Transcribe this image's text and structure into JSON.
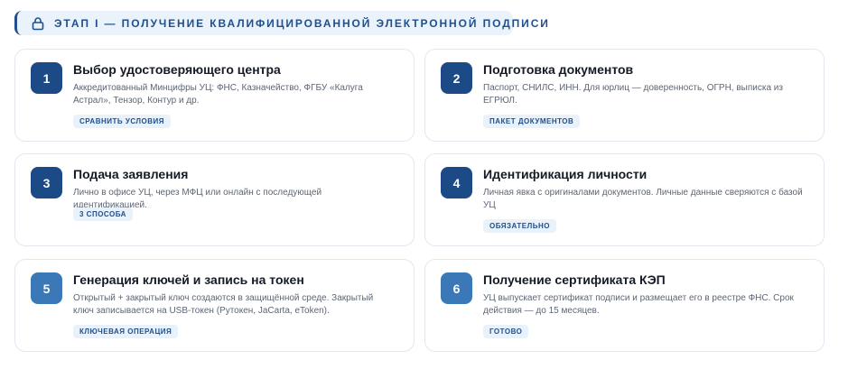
{
  "stage": {
    "title": "ЭТАП I — ПОЛУЧЕНИЕ КВАЛИФИЦИРОВАННОЙ ЭЛЕКТРОННОЙ ПОДПИСИ",
    "icon": "lock-icon"
  },
  "colors": {
    "accent": "#1f4f8c",
    "badge_dark": "#1b4a86",
    "badge_light": "#3a78b8"
  },
  "steps": [
    {
      "number": "1",
      "title": "Выбор удостоверяющего центра",
      "description": "Аккредитованный Минцифры УЦ: ФНС, Казначейство, ФГБУ «Калуга Астрал», Тензор, Контур и др.",
      "tag": "СРАВНИТЬ УСЛОВИЯ"
    },
    {
      "number": "2",
      "title": "Подготовка документов",
      "description": "Паспорт, СНИЛС, ИНН. Для юрлиц — доверенность, ОГРН, выписка из ЕГРЮЛ.",
      "tag": "ПАКЕТ ДОКУМЕНТОВ"
    },
    {
      "number": "3",
      "title": "Подача заявления",
      "description": "Лично в офисе УЦ, через МФЦ или онлайн с последующей идентификацией.",
      "tag": "3 СПОСОБА"
    },
    {
      "number": "4",
      "title": "Идентификация личности",
      "description": "Личная явка с оригиналами документов. Личные данные сверяются с базой УЦ",
      "tag": "ОБЯЗАТЕЛЬНО"
    },
    {
      "number": "5",
      "title": "Генерация ключей и запись на токен",
      "description": "Открытый + закрытый ключ создаются в защищённой среде. Закрытый ключ записывается на USB-токен (Рутокен, JaCarta, eToken).",
      "tag": "КЛЮЧЕВАЯ ОПЕРАЦИЯ"
    },
    {
      "number": "6",
      "title": "Получение сертификата КЭП",
      "description": "УЦ выпускает сертификат подписи и размещает его в реестре ФНС. Срок действия — до 15 месяцев.",
      "tag": "ГОТОВО"
    }
  ]
}
